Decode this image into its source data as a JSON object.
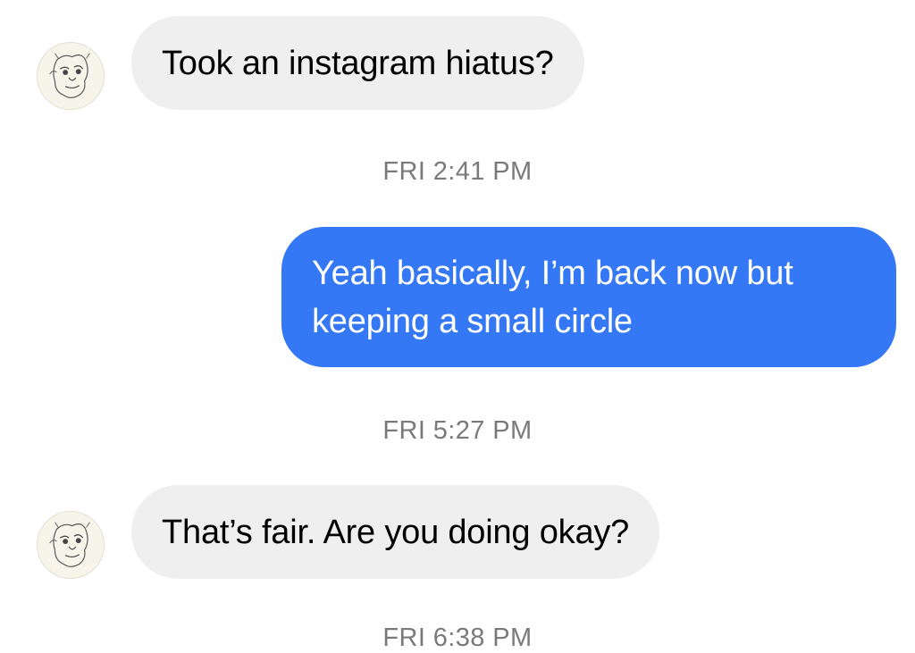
{
  "colors": {
    "incoming_bubble": "#efefef",
    "outgoing_bubble": "#3478f6",
    "timestamp_text": "#7a7a7a"
  },
  "messages": [
    {
      "direction": "incoming",
      "avatar_icon": "sketch-face-avatar",
      "text": "Took an instagram hiatus?"
    },
    {
      "type": "timestamp",
      "text": "FRI 2:41 PM"
    },
    {
      "direction": "outgoing",
      "lines": [
        "Yeah basically, I’m back now but",
        "keeping a small circle"
      ]
    },
    {
      "type": "timestamp",
      "text": "FRI 5:27 PM"
    },
    {
      "direction": "incoming",
      "avatar_icon": "sketch-face-avatar",
      "text": "That’s fair. Are you doing okay?"
    },
    {
      "type": "timestamp",
      "text": "FRI 6:38 PM"
    }
  ]
}
